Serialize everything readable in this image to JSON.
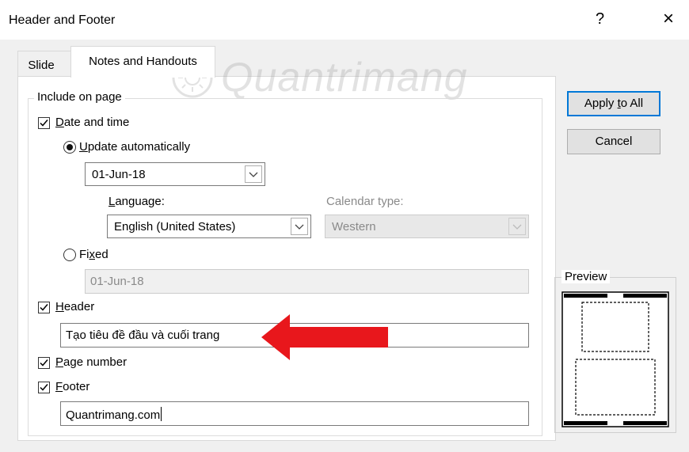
{
  "window": {
    "title": "Header and Footer",
    "help_label": "?",
    "close_label": "×"
  },
  "watermark": {
    "text": "Quantrimang"
  },
  "tabs": [
    {
      "label": "Slide",
      "active": false
    },
    {
      "label": "Notes and Handouts",
      "active": true
    }
  ],
  "include_group": {
    "legend": "Include on page"
  },
  "date_time": {
    "label_prefix": "D",
    "label_rest": "ate and time",
    "checked": true,
    "update_auto": {
      "label_prefix": "U",
      "label_rest": "pdate automatically",
      "selected": true
    },
    "date_value": "01-Jun-18",
    "language": {
      "label_prefix": "L",
      "label_rest": "anguage:",
      "value": "English (United States)"
    },
    "calendar": {
      "label": "Calendar type:",
      "value": "Western",
      "disabled": true
    },
    "fixed": {
      "label_prefix": "Fi",
      "label_u": "x",
      "label_rest": "ed",
      "selected": false,
      "value": "01-Jun-18"
    }
  },
  "header": {
    "label_prefix": "H",
    "label_rest": "eader",
    "checked": true,
    "value": "Tạo tiêu đề đầu và cuối trang"
  },
  "page_number": {
    "label_prefix": "P",
    "label_rest": "age number",
    "checked": true
  },
  "footer": {
    "label_prefix": "F",
    "label_rest": "ooter",
    "checked": true,
    "value": "Quantrimang.com"
  },
  "buttons": {
    "apply_all": {
      "label_prefix": "Apply ",
      "label_u": "t",
      "label_rest": "o All"
    },
    "cancel": {
      "label": "Cancel"
    }
  },
  "preview": {
    "label": "Preview"
  },
  "colors": {
    "arrow": "#e8171c",
    "accent": "#0078d7"
  }
}
